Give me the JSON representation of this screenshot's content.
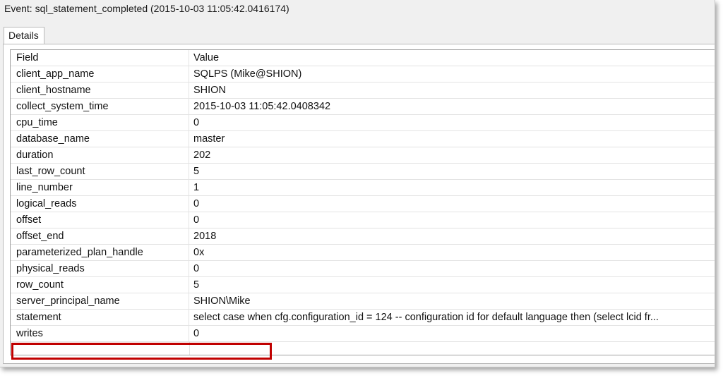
{
  "window": {
    "title": "Event: sql_statement_completed (2015-10-03 11:05:42.0416174)"
  },
  "tabs": [
    {
      "label": "Details"
    }
  ],
  "grid": {
    "headers": {
      "field": "Field",
      "value": "Value"
    },
    "rows": [
      {
        "field": "client_app_name",
        "value": "SQLPS (Mike@SHION)"
      },
      {
        "field": "client_hostname",
        "value": "SHION"
      },
      {
        "field": "collect_system_time",
        "value": "2015-10-03 11:05:42.0408342"
      },
      {
        "field": "cpu_time",
        "value": "0"
      },
      {
        "field": "database_name",
        "value": "master"
      },
      {
        "field": "duration",
        "value": "202"
      },
      {
        "field": "last_row_count",
        "value": "5"
      },
      {
        "field": "line_number",
        "value": "1"
      },
      {
        "field": "logical_reads",
        "value": "0"
      },
      {
        "field": "offset",
        "value": "0"
      },
      {
        "field": "offset_end",
        "value": "2018"
      },
      {
        "field": "parameterized_plan_handle",
        "value": "0x"
      },
      {
        "field": "physical_reads",
        "value": "0"
      },
      {
        "field": "row_count",
        "value": "5"
      },
      {
        "field": "server_principal_name",
        "value": "SHION\\Mike"
      },
      {
        "field": "statement",
        "value": "select   case    when cfg.configuration_id = 124 -- configuration id for default language   then (select lcid fr..."
      },
      {
        "field": "writes",
        "value": "0"
      }
    ]
  },
  "colors": {
    "highlight_box": "#c00000",
    "window_background": "#f0f0f0",
    "grid_line": "#e3e3e3"
  }
}
